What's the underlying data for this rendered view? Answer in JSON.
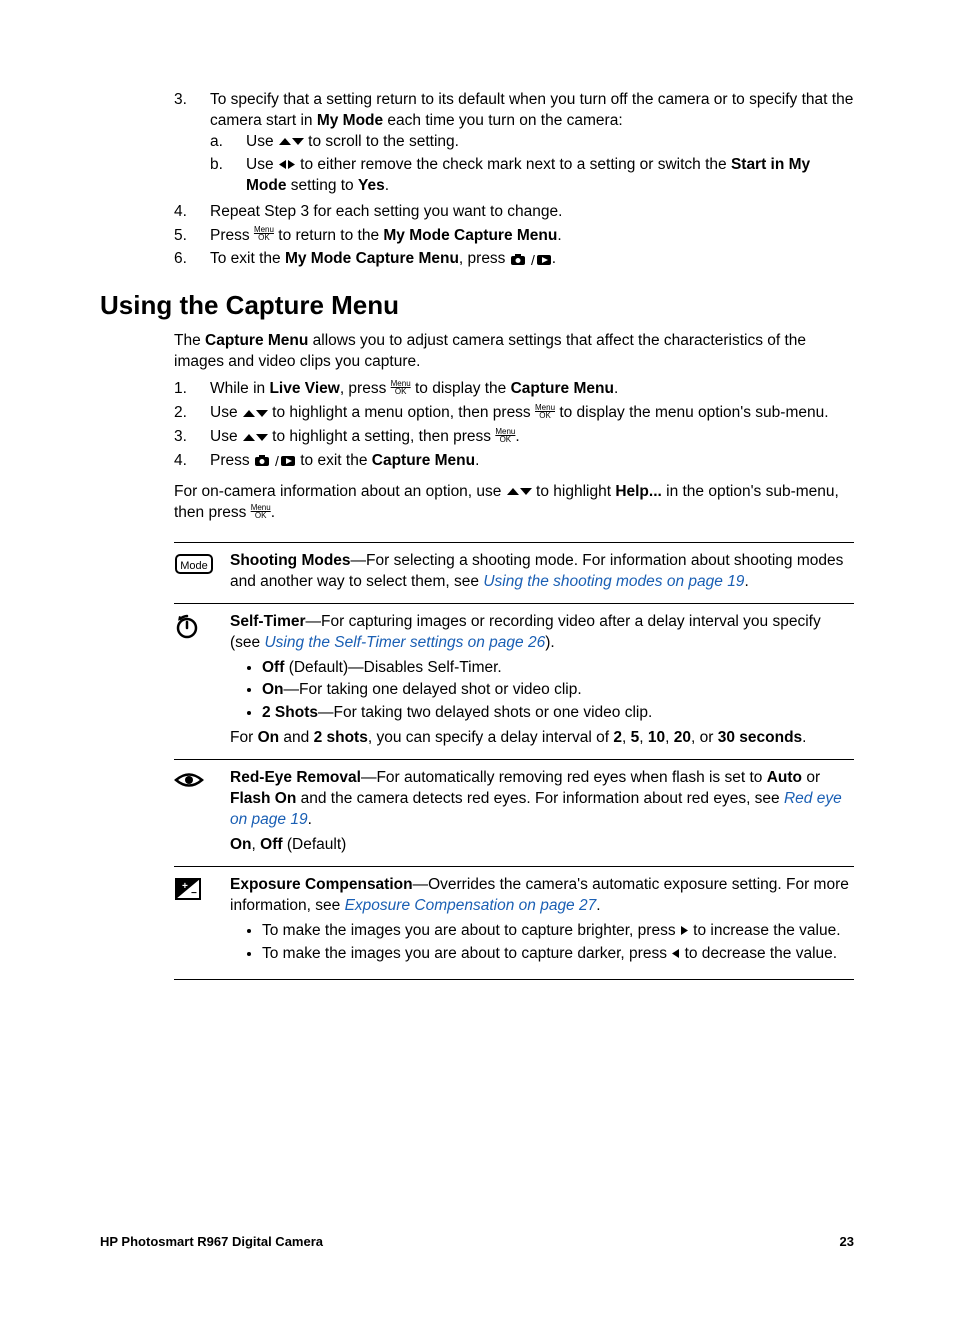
{
  "intro_steps": [
    {
      "num": "3.",
      "text_before": "To specify that a setting return to its default when you turn off the camera or to specify that the camera start in ",
      "bold1": "My Mode",
      "text_after": " each time you turn on the camera:",
      "substeps": [
        {
          "num": "a.",
          "pre": "Use ",
          "post": " to scroll to the setting.",
          "icon": "updown"
        },
        {
          "num": "b.",
          "pre": "Use ",
          "mid": " to either remove the check mark next to a setting or switch the ",
          "bold": "Start in My Mode",
          "post2": " setting to ",
          "bold2": "Yes",
          "post3": ".",
          "icon": "leftright"
        }
      ]
    },
    {
      "num": "4.",
      "text": "Repeat Step 3 for each setting you want to change."
    },
    {
      "num": "5.",
      "pre": "Press ",
      "icon": "menuok",
      "mid": " to return to the ",
      "bold": "My Mode Capture Menu",
      "post": "."
    },
    {
      "num": "6.",
      "pre": "To exit the ",
      "bold": "My Mode Capture Menu",
      "mid": ", press ",
      "icon": "camplay",
      "post": "."
    }
  ],
  "heading": "Using the Capture Menu",
  "intro_para_pre": "The ",
  "intro_para_bold": "Capture Menu",
  "intro_para_post": " allows you to adjust camera settings that affect the characteristics of the images and video clips you capture.",
  "capture_steps": [
    {
      "num": "1.",
      "pre": "While in ",
      "bold1": "Live View",
      "mid1": ", press ",
      "icon1": "menuok",
      "mid2": " to display the ",
      "bold2": "Capture Menu",
      "post": "."
    },
    {
      "num": "2.",
      "pre": "Use ",
      "icon1": "updown",
      "mid1": " to highlight a menu option, then press ",
      "icon2": "menuok",
      "post": " to display the menu option's sub-menu."
    },
    {
      "num": "3.",
      "pre": "Use ",
      "icon1": "updown",
      "mid1": " to highlight a setting, then press ",
      "icon2": "menuok",
      "post": "."
    },
    {
      "num": "4.",
      "pre": "Press ",
      "icon1": "camplay",
      "mid1": " to exit the ",
      "bold1": "Capture Menu",
      "post": "."
    }
  ],
  "help_note": {
    "pre": "For on-camera information about an option, use ",
    "icon1": "updown",
    "mid": " to highlight ",
    "bold": "Help...",
    "mid2": " in the option's sub-menu, then press ",
    "icon2": "menuok",
    "post": "."
  },
  "menu_items": [
    {
      "icon": "mode",
      "title": "Shooting Modes",
      "desc_pre": "—For selecting a shooting mode. For information about shooting modes and another way to select them, see ",
      "xref": "Using the shooting modes",
      "xref_post": " on page 19",
      "desc_post": "."
    },
    {
      "icon": "timer",
      "title": "Self-Timer",
      "desc_pre": "—For capturing images or recording video after a delay interval you specify (see ",
      "xref": "Using the Self-Timer settings",
      "xref_post": " on page 26",
      "desc_post": ").",
      "bullets": [
        {
          "bold": "Off",
          "rest": " (Default)—Disables Self-Timer."
        },
        {
          "bold": "On",
          "rest": "—For taking one delayed shot or video clip."
        },
        {
          "bold": "2 Shots",
          "rest": "—For taking two delayed shots or one video clip."
        }
      ],
      "extra_pre": "For ",
      "extra_b1": "On",
      "extra_mid1": " and ",
      "extra_b2": "2 shots",
      "extra_mid2": ", you can specify a delay interval of ",
      "extra_b3": "2",
      "extra_c1": ", ",
      "extra_b4": "5",
      "extra_c2": ", ",
      "extra_b5": "10",
      "extra_c3": ", ",
      "extra_b6": "20",
      "extra_c4": ", or ",
      "extra_b7": "30 seconds",
      "extra_post": "."
    },
    {
      "icon": "eye",
      "title": "Red-Eye Removal",
      "desc_pre": "—For automatically removing red eyes when flash is set to ",
      "b1": "Auto",
      "mid1": " or ",
      "b2": "Flash On",
      "mid2": " and the camera detects red eyes. For information about red eyes, see ",
      "xref": "Red eye",
      "xref_post": " on page 19",
      "desc_post": ".",
      "options_b1": "On",
      "options_mid": ", ",
      "options_b2": "Off",
      "options_post": " (Default)"
    },
    {
      "icon": "expcomp",
      "title": "Exposure Compensation",
      "desc_pre": "—Overrides the camera's automatic exposure setting. For more information, see ",
      "xref": "Exposure Compensation",
      "xref_post": " on page 27",
      "desc_post": ".",
      "bullets": [
        {
          "pre": "To make the images you are about to capture brighter, press ",
          "icon": "right",
          "post": " to increase the value."
        },
        {
          "pre": "To make the images you are about to capture darker, press ",
          "icon": "left",
          "post": " to decrease the value."
        }
      ]
    }
  ],
  "footer_left": "HP Photosmart R967 Digital Camera",
  "footer_right": "23"
}
